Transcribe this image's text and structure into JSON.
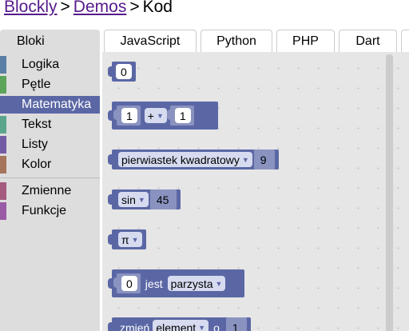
{
  "breadcrumb": {
    "link1": "Blockly",
    "sep1": ">",
    "link2": "Demos",
    "sep2": ">",
    "current": "Kod"
  },
  "tabs": [
    "Bloki",
    "JavaScript",
    "Python",
    "PHP",
    "Dart"
  ],
  "categories": [
    {
      "label": "Logika",
      "color": "#5b80a5"
    },
    {
      "label": "Pętle",
      "color": "#5ba55b"
    },
    {
      "label": "Matematyka",
      "color": "#5b67a5"
    },
    {
      "label": "Tekst",
      "color": "#5ba58c"
    },
    {
      "label": "Listy",
      "color": "#745ba5"
    },
    {
      "label": "Kolor",
      "color": "#a5745b"
    },
    {
      "label": "Zmienne",
      "color": "#a55b80"
    },
    {
      "label": "Funkcje",
      "color": "#995ba5"
    }
  ],
  "blocks": {
    "number": {
      "value": "0"
    },
    "arithmetic": {
      "a": "1",
      "op": "+",
      "b": "1"
    },
    "single": {
      "op": "pierwiastek kwadratowy",
      "value": "9"
    },
    "trig": {
      "op": "sin",
      "value": "45"
    },
    "constant": {
      "op": "π"
    },
    "property": {
      "value": "0",
      "word": "jest",
      "op": "parzysta"
    },
    "change": {
      "word": "zmień",
      "var": "element",
      "by": "o",
      "value": "1"
    }
  },
  "colors": {
    "math": "#5b67a5",
    "selected": "#5b67a5",
    "toolbox": "#dddddd",
    "workspace": "#e6e6e6"
  }
}
